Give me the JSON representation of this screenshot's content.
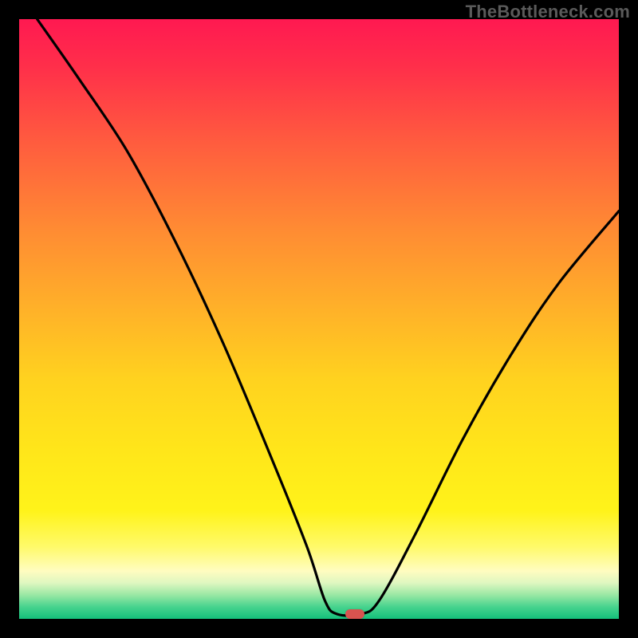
{
  "watermark": "TheBottleneck.com",
  "colors": {
    "frame_bg": "#000000",
    "gradient_stops": [
      {
        "pos": "0%",
        "hex": "#ff1951"
      },
      {
        "pos": "8%",
        "hex": "#ff2f4a"
      },
      {
        "pos": "20%",
        "hex": "#ff5a3f"
      },
      {
        "pos": "35%",
        "hex": "#ff8b33"
      },
      {
        "pos": "48%",
        "hex": "#ffb029"
      },
      {
        "pos": "60%",
        "hex": "#ffd21f"
      },
      {
        "pos": "72%",
        "hex": "#ffe61a"
      },
      {
        "pos": "82%",
        "hex": "#fff31a"
      },
      {
        "pos": "88%",
        "hex": "#fffa6a"
      },
      {
        "pos": "92%",
        "hex": "#fffcc0"
      },
      {
        "pos": "94%",
        "hex": "#dff7c0"
      },
      {
        "pos": "96%",
        "hex": "#9ae8a4"
      },
      {
        "pos": "98%",
        "hex": "#47d38e"
      },
      {
        "pos": "100%",
        "hex": "#14c07b"
      }
    ],
    "curve_stroke": "#000000",
    "marker_fill": "#d9534f"
  },
  "chart_data": {
    "type": "line",
    "title": "",
    "xlabel": "",
    "ylabel": "",
    "xlim": [
      0,
      100
    ],
    "ylim": [
      0,
      100
    ],
    "series": [
      {
        "name": "bottleneck-curve",
        "points": [
          {
            "x": 3,
            "y": 100
          },
          {
            "x": 10,
            "y": 90
          },
          {
            "x": 18,
            "y": 78
          },
          {
            "x": 26,
            "y": 63
          },
          {
            "x": 34,
            "y": 46
          },
          {
            "x": 42,
            "y": 27
          },
          {
            "x": 48,
            "y": 12
          },
          {
            "x": 51,
            "y": 3
          },
          {
            "x": 53,
            "y": 0.8
          },
          {
            "x": 57,
            "y": 0.8
          },
          {
            "x": 60,
            "y": 3
          },
          {
            "x": 66,
            "y": 14
          },
          {
            "x": 74,
            "y": 30
          },
          {
            "x": 82,
            "y": 44
          },
          {
            "x": 90,
            "y": 56
          },
          {
            "x": 100,
            "y": 68
          }
        ]
      }
    ],
    "marker": {
      "x": 56,
      "y": 0.8
    }
  }
}
